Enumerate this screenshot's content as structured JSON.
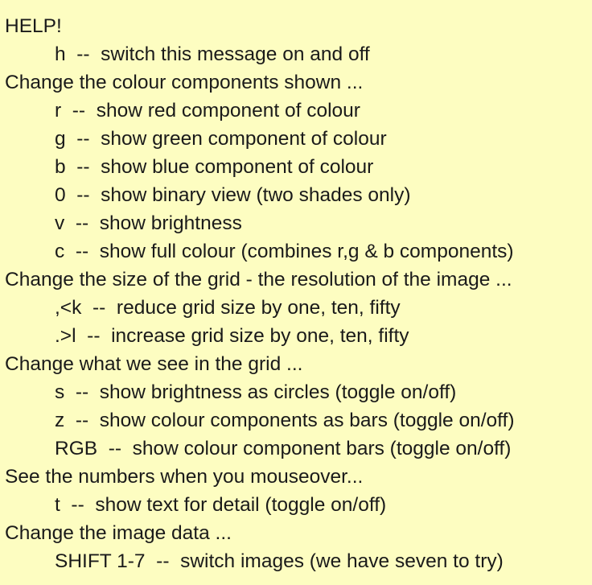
{
  "help": {
    "lines": [
      {
        "kind": "heading",
        "text": "HELP!"
      },
      {
        "kind": "item",
        "text": "h  --  switch this message on and off"
      },
      {
        "kind": "heading",
        "text": "Change the colour components shown ..."
      },
      {
        "kind": "item",
        "text": "r  --  show red component of colour"
      },
      {
        "kind": "item",
        "text": "g  --  show green component of colour"
      },
      {
        "kind": "item",
        "text": "b  --  show blue component of colour"
      },
      {
        "kind": "item",
        "text": "0  --  show binary view (two shades only)"
      },
      {
        "kind": "item",
        "text": "v  --  show brightness"
      },
      {
        "kind": "item",
        "text": "c  --  show full colour (combines r,g & b components)"
      },
      {
        "kind": "heading",
        "text": "Change the size of the grid - the resolution of the image ..."
      },
      {
        "kind": "item",
        "text": ",<k  --  reduce grid size by one, ten, fifty"
      },
      {
        "kind": "item",
        "text": ".>l  --  increase grid size by one, ten, fifty"
      },
      {
        "kind": "heading",
        "text": "Change what we see in the grid ..."
      },
      {
        "kind": "item",
        "text": "s  --  show brightness as circles (toggle on/off)"
      },
      {
        "kind": "item",
        "text": "z  --  show colour components as bars (toggle on/off)"
      },
      {
        "kind": "item",
        "text": "RGB  --  show colour component bars (toggle on/off)"
      },
      {
        "kind": "heading",
        "text": "See the numbers when you mouseover..."
      },
      {
        "kind": "item",
        "text": "t  --  show text for detail (toggle on/off)"
      },
      {
        "kind": "heading",
        "text": "Change the image data ..."
      },
      {
        "kind": "item",
        "text": "SHIFT 1-7  --  switch images (we have seven to try)"
      }
    ]
  },
  "colors": {
    "background": "#fdfdc1",
    "text": "#1a1a1a"
  }
}
